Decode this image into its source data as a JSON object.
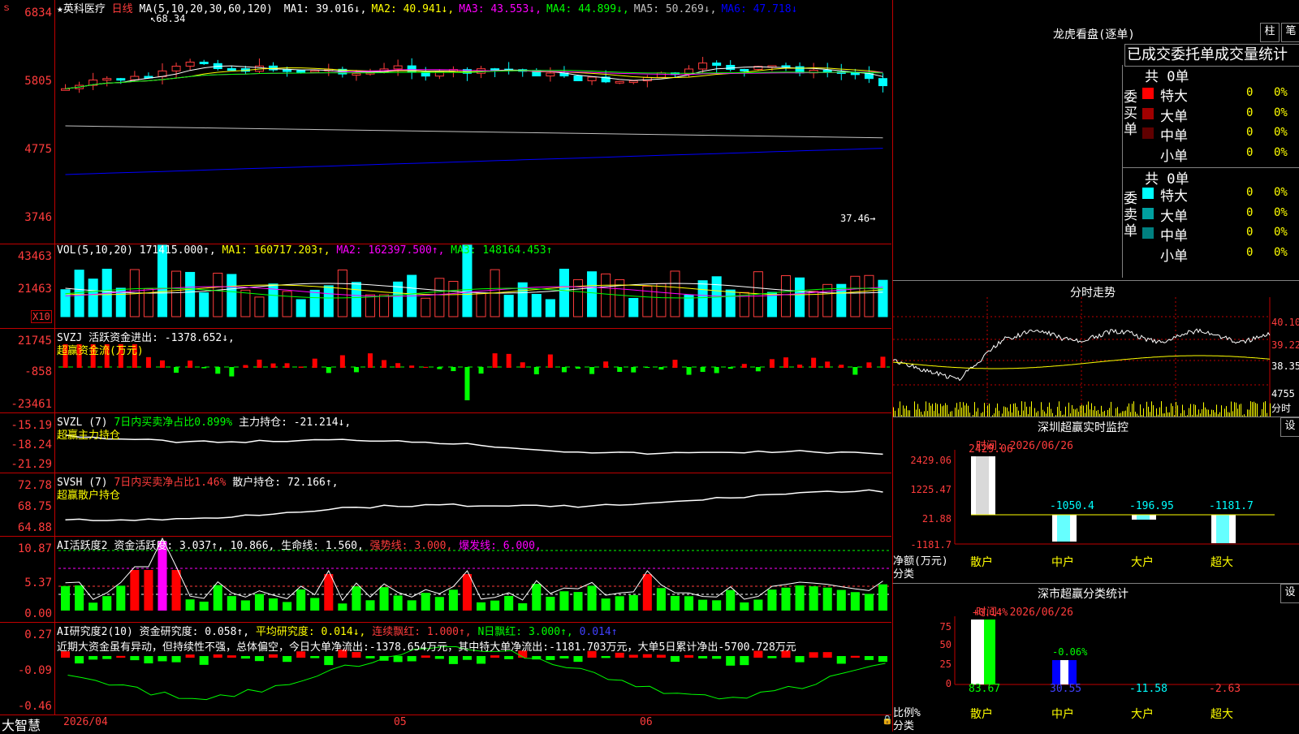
{
  "stock": {
    "star": "★",
    "name": "英科医疗",
    "period": "日线"
  },
  "k_axis": {
    "top": "6834",
    "l2": "5805",
    "l3": "4775",
    "l4": "3746",
    "high_mark": "68.34",
    "low_mark": "37.46"
  },
  "ma": {
    "title": "MA(5,10,20,30,60,120)",
    "items": [
      {
        "label": "MA1: 39.016↓,",
        "color": "#ffffff"
      },
      {
        "label": "MA2: 40.941↓,",
        "color": "#ffff00"
      },
      {
        "label": "MA3: 43.553↓,",
        "color": "#ff00ff"
      },
      {
        "label": "MA4: 44.899↓,",
        "color": "#00ff00"
      },
      {
        "label": "MA5: 50.269↓,",
        "color": "#c0c0c0"
      },
      {
        "label": "MA6: 47.718↓",
        "color": "#0000ff"
      }
    ]
  },
  "vol": {
    "axis": [
      "43463",
      "21463"
    ],
    "unit": "X10",
    "title": "VOL(5,10,20)",
    "val": "171415.000↑,",
    "ma1": "MA1: 160717.203↑,",
    "ma2": "MA2: 162397.500↑,",
    "ma3": "MA3: 148164.453↑"
  },
  "svzj": {
    "axis": [
      "21745",
      "-858",
      "-23461"
    ],
    "title": "SVZJ",
    "label": "活跃资金进出: -1378.652↓,",
    "sub": "超赢资金流(万元)"
  },
  "svzl": {
    "axis": [
      "-15.19",
      "-18.24",
      "-21.29"
    ],
    "title": "SVZL (7)",
    "pct": "7日内买卖净占比0.899%",
    "hold": "主力持仓: -21.214↓,",
    "sub": "超赢主力持仓"
  },
  "svsh": {
    "axis": [
      "72.78",
      "68.75",
      "64.88"
    ],
    "title": "SVSH (7)",
    "pct": "7日内买卖净占比1.46%",
    "hold": "散户持仓: 72.166↑,",
    "sub": "超赢散户持仓"
  },
  "ai1": {
    "axis": [
      "10.87",
      "5.37",
      "0.00"
    ],
    "title": "AI活跃度2",
    "a": "资金活跃度: 3.037↑,",
    "b": "10.866,",
    "c": "生命线: 1.560,",
    "d": "强势线: 3.000,",
    "e": "爆发线: 6.000,"
  },
  "ai2": {
    "axis": [
      "0.27",
      "-0.09",
      "-0.46"
    ],
    "title": "AI研究度2(10)",
    "a": "资金研究度: 0.058↑,",
    "b": "平均研究度: 0.014↓,",
    "c": "连续飘红: 1.000↑,",
    "d": "N日飘红: 3.000↑,",
    "e": "0.014↑",
    "comment": "近期大资金虽有异动，但持续性不强，总体偏空，今日大单净流出:-1378.654万元，其中特大单净流出:-1181.703万元，大单5日累计净出-5700.728万元"
  },
  "xaxis": {
    "brand": "大智慧",
    "d1": "2026/04",
    "d2": "05",
    "d3": "06"
  },
  "dragon": {
    "title": "龙虎看盘(逐单)",
    "btn1": "柱",
    "btn2": "笔",
    "tabs": "已成交委托单成交量统计",
    "buy": {
      "side": "委买单",
      "total": "共 0单",
      "rows": [
        {
          "label": "特大",
          "v": "0",
          "p": "0%",
          "color": "#ff0000"
        },
        {
          "label": "大单",
          "v": "0",
          "p": "0%",
          "color": "#a00000"
        },
        {
          "label": "中单",
          "v": "0",
          "p": "0%",
          "color": "#600000"
        },
        {
          "label": "小单",
          "v": "0",
          "p": "0%",
          "color": "#000000"
        }
      ]
    },
    "sell": {
      "side": "委卖单",
      "total": "共 0单",
      "rows": [
        {
          "label": "特大",
          "v": "0",
          "p": "0%",
          "color": "#00ffff"
        },
        {
          "label": "大单",
          "v": "0",
          "p": "0%",
          "color": "#00a0a0"
        },
        {
          "label": "中单",
          "v": "0",
          "p": "0%",
          "color": "#008080"
        },
        {
          "label": "小单",
          "v": "0",
          "p": "0%",
          "color": "#000000"
        }
      ]
    }
  },
  "intraday": {
    "title": "分时走势",
    "axis": [
      "40.10",
      "39.22",
      "38.35"
    ],
    "vol": "4755",
    "sub": "分时"
  },
  "sz_monitor": {
    "title": "深圳超赢实时监控",
    "btn": "设",
    "time": "时间: 2026/06/26",
    "axis": [
      "2429.06",
      "1225.47",
      "21.88",
      "-1181.7"
    ],
    "ylabel": "净额(万元)",
    "xlabel": "分类",
    "cats": [
      "散户",
      "中户",
      "大户",
      "超大"
    ],
    "values": [
      "2429.06",
      "-1050.4",
      "-196.95",
      "-1181.7"
    ]
  },
  "sz_class": {
    "title": "深市超赢分类统计",
    "btn": "设",
    "time": "时间: 2026/06/26",
    "axis": [
      "75",
      "50",
      "25",
      "0"
    ],
    "ylabel": "比例%",
    "xlabel": "分类",
    "cats": [
      "散户",
      "中户",
      "大户",
      "超大"
    ],
    "top": [
      "+0.14%",
      "-0.06%"
    ],
    "values": [
      "83.67",
      "30.55",
      "-11.58",
      "-2.63"
    ]
  }
}
